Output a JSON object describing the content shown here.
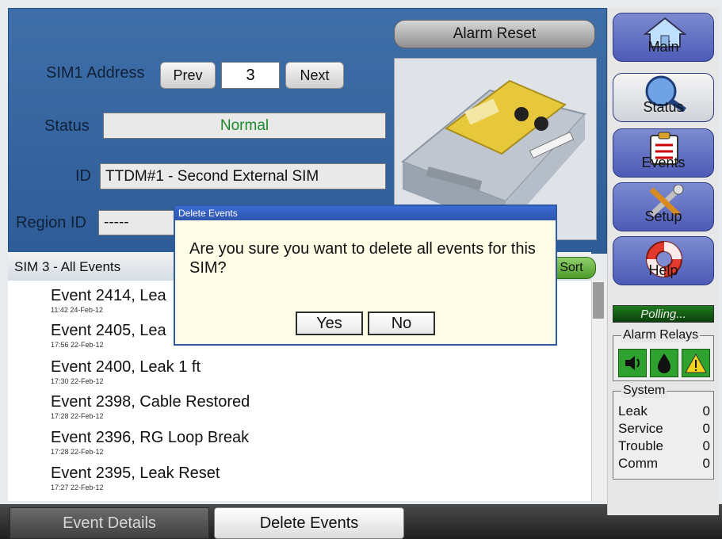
{
  "top": {
    "address_label": "SIM1 Address",
    "prev_label": "Prev",
    "address_value": "3",
    "next_label": "Next",
    "status_label": "Status",
    "status_value": "Normal",
    "id_label": "ID",
    "id_value": "TTDM#1 - Second External SIM",
    "region_label": "Region ID",
    "region_value": "-----",
    "alarm_reset_label": "Alarm Reset"
  },
  "list": {
    "header": "SIM 3 - All Events",
    "sort_label": "Sort",
    "events": [
      {
        "title": "Event 2414, Lea",
        "time": "11:42 24-Feb-12"
      },
      {
        "title": "Event 2405, Lea",
        "time": "17:56 22-Feb-12"
      },
      {
        "title": "Event 2400, Leak 1 ft",
        "time": "17:30 22-Feb-12"
      },
      {
        "title": "Event 2398, Cable Restored",
        "time": "17:28 22-Feb-12"
      },
      {
        "title": "Event 2396, RG Loop Break",
        "time": "17:28 22-Feb-12"
      },
      {
        "title": "Event 2395, Leak Reset",
        "time": "17:27 22-Feb-12"
      }
    ]
  },
  "bottom": {
    "event_details_label": "Event Details",
    "delete_events_label": "Delete Events"
  },
  "dialog": {
    "title": "Delete Events",
    "message": "Are you sure you want to delete all events for this SIM?",
    "yes_label": "Yes",
    "no_label": "No"
  },
  "sidebar": {
    "main_label": "Main",
    "status_label": "Status",
    "events_label": "Events",
    "setup_label": "Setup",
    "help_label": "Help",
    "polling_label": "Polling...",
    "alarm_relays_label": "Alarm Relays",
    "system_label": "System",
    "system_rows": [
      {
        "label": "Leak",
        "value": "0"
      },
      {
        "label": "Service",
        "value": "0"
      },
      {
        "label": "Trouble",
        "value": "0"
      },
      {
        "label": "Comm",
        "value": "0"
      }
    ]
  },
  "colors": {
    "panel_blue": "#3f6fa8",
    "status_green": "#1d8a2c",
    "dialog_title_blue": "#2f56ad"
  }
}
